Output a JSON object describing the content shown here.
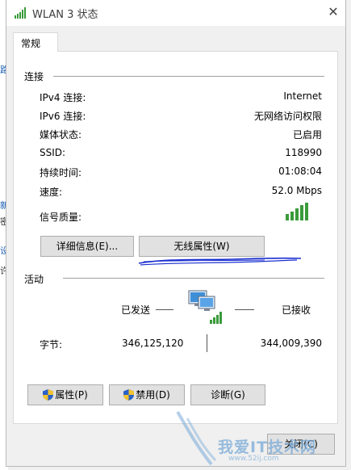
{
  "window": {
    "title": "WLAN 3 状态",
    "close_glyph": "✕",
    "icon": "wifi-signal-icon"
  },
  "tabs": [
    {
      "label": "常规",
      "selected": true
    }
  ],
  "connection": {
    "heading": "连接",
    "rows": [
      {
        "label": "IPv4 连接:",
        "value": "Internet"
      },
      {
        "label": "IPv6 连接:",
        "value": "无网络访问权限"
      },
      {
        "label": "媒体状态:",
        "value": "已启用"
      },
      {
        "label": "SSID:",
        "value": "118990"
      },
      {
        "label": "持续时间:",
        "value": "01:08:04"
      },
      {
        "label": "速度:",
        "value": "52.0 Mbps"
      }
    ],
    "signal_label": "信号质量:",
    "signal_bars_filled": 5,
    "signal_bars_total": 5,
    "signal_color": "#3a9a3a",
    "details_button": "详细信息(E)...",
    "wireless_props_button": "无线属性(W)"
  },
  "activity": {
    "heading": "活动",
    "sent_label": "已发送",
    "received_label": "已接收",
    "bytes_label": "字节:",
    "bytes_sent": "346,125,120",
    "bytes_received": "344,009,390"
  },
  "buttons": {
    "properties": "属性(P)",
    "disable": "禁用(D)",
    "diagnose": "诊断(G)",
    "close": "关闭(C)"
  },
  "left_edge_glyphs": [
    "路",
    "新",
    "密",
    "设",
    "许"
  ],
  "watermark": {
    "text": "我爱IT技术网",
    "url": "www.52ij.com"
  },
  "colors": {
    "accent_blue": "#1a5fb4",
    "scribble": "#1a2fd0",
    "shield_blue": "#2a62c9",
    "shield_yellow": "#f2c230"
  }
}
